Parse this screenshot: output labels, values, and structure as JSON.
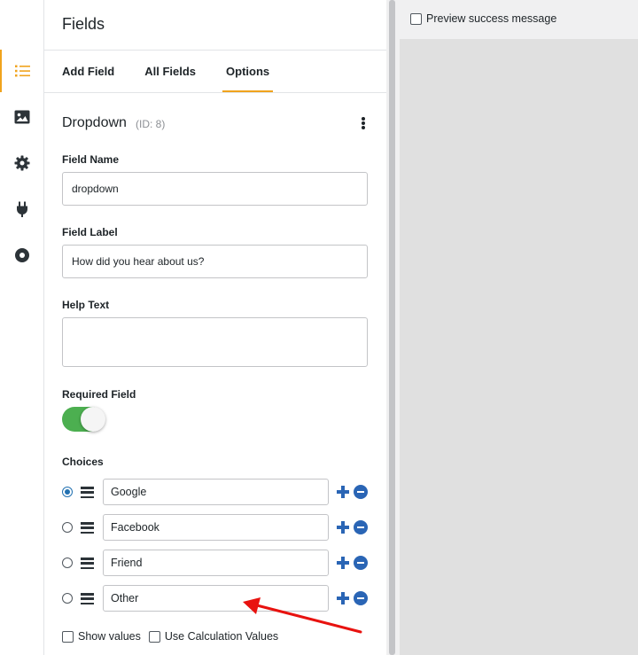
{
  "rail": {
    "items": [
      {
        "icon": "list-icon",
        "active": true
      },
      {
        "icon": "image-icon",
        "active": false
      },
      {
        "icon": "gear-icon",
        "active": false
      },
      {
        "icon": "plug-icon",
        "active": false
      },
      {
        "icon": "record-icon",
        "active": false
      }
    ]
  },
  "panel": {
    "title": "Fields",
    "tabs": [
      {
        "label": "Add Field",
        "active": false
      },
      {
        "label": "All Fields",
        "active": false
      },
      {
        "label": "Options",
        "active": true
      }
    ]
  },
  "field": {
    "title": "Dropdown",
    "id_label": "(ID: 8)",
    "name_label": "Field Name",
    "name_value": "dropdown",
    "label_label": "Field Label",
    "label_value": "How did you hear about us?",
    "help_label": "Help Text",
    "help_value": "",
    "required_label": "Required Field",
    "required_on": true
  },
  "choices": {
    "label": "Choices",
    "items": [
      {
        "value": "Google",
        "selected": true
      },
      {
        "value": "Facebook",
        "selected": false
      },
      {
        "value": "Friend",
        "selected": false
      },
      {
        "value": "Other",
        "selected": false
      }
    ],
    "show_values_label": "Show values",
    "calc_values_label": "Use Calculation Values"
  },
  "preview": {
    "success_label": "Preview success message"
  },
  "colors": {
    "accent": "#f0a31d",
    "toggle_on": "#4caf50",
    "action_blue": "#2a65b5",
    "annotation_arrow": "#e8120f"
  }
}
